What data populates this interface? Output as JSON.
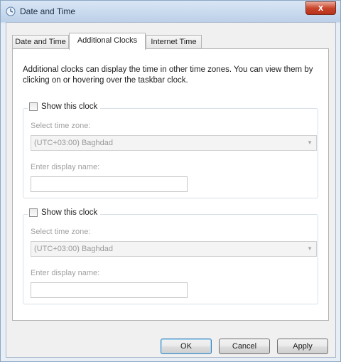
{
  "window": {
    "title": "Date and Time",
    "close_glyph": "x",
    "app_icon": "clock-icon"
  },
  "tabs": [
    {
      "label": "Date and Time",
      "active": false
    },
    {
      "label": "Additional Clocks",
      "active": true
    },
    {
      "label": "Internet Time",
      "active": false
    }
  ],
  "description": "Additional clocks can display the time in other time zones. You can view them by clicking on or hovering over the taskbar clock.",
  "clocks": [
    {
      "show_label": "Show this clock",
      "checked": false,
      "timezone_label": "Select time zone:",
      "timezone_value": "(UTC+03:00) Baghdad",
      "display_name_label": "Enter display name:",
      "display_name_value": ""
    },
    {
      "show_label": "Show this clock",
      "checked": false,
      "timezone_label": "Select time zone:",
      "timezone_value": "(UTC+03:00) Baghdad",
      "display_name_label": "Enter display name:",
      "display_name_value": ""
    }
  ],
  "buttons": {
    "ok": "OK",
    "cancel": "Cancel",
    "apply": "Apply"
  },
  "colors": {
    "close_button": "#c9452c",
    "default_button_border": "#3c7fb1"
  }
}
